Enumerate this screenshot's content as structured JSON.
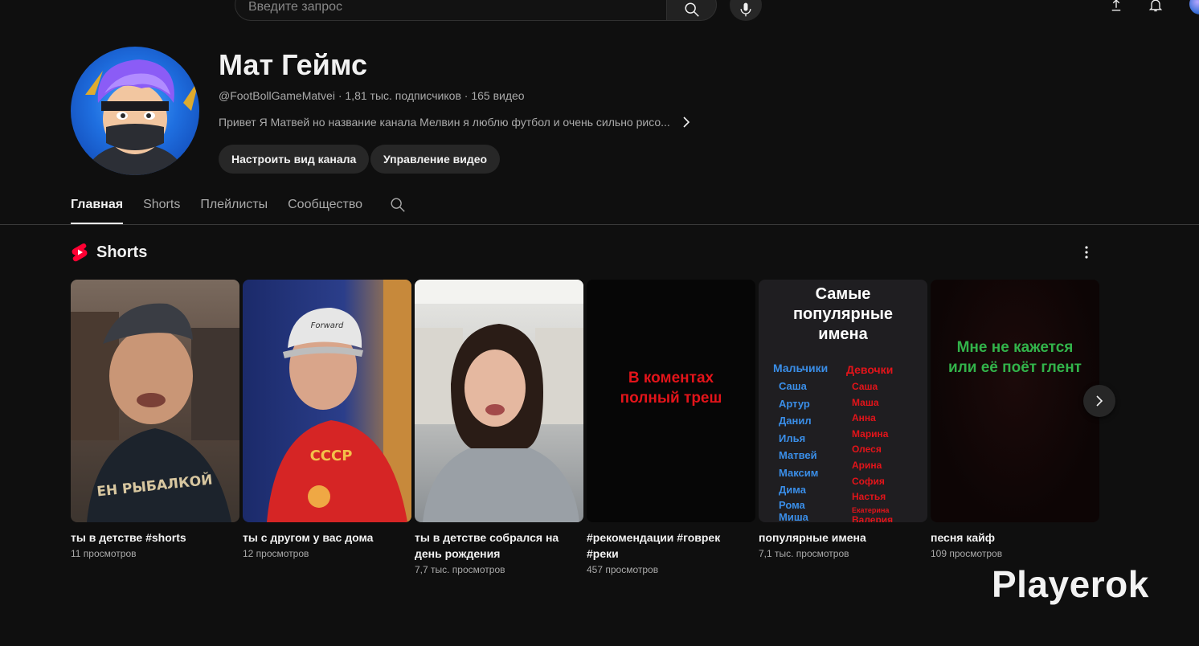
{
  "topbar": {
    "search_placeholder": "Введите запрос",
    "search_icon": "search-icon",
    "mic_icon": "mic-icon",
    "upload_icon": "upload-icon",
    "bell_icon": "bell-icon"
  },
  "channel": {
    "name": "Мат Геймс",
    "handle": "@FootBollGameMatvei",
    "subscribers": "1,81 тыс. подписчиков",
    "videos": "165 видео",
    "separator": " · ",
    "description": "Привет Я Матвей но название канала Мелвин я люблю футбол и очень сильно рисо...",
    "customize_label": "Настроить вид канала",
    "manage_label": "Управление видео"
  },
  "tabs": [
    {
      "label": "Главная",
      "active": true
    },
    {
      "label": "Shorts",
      "active": false
    },
    {
      "label": "Плейлисты",
      "active": false
    },
    {
      "label": "Сообщество",
      "active": false
    }
  ],
  "shelf": {
    "title": "Shorts",
    "brand_color": "#ff0033"
  },
  "shorts": [
    {
      "title": "ты в детстве #shorts",
      "views": "11 просмотров"
    },
    {
      "title": "ты с другом у вас дома",
      "views": "12 просмотров"
    },
    {
      "title": "ты в детстве собрался на день рождения",
      "views": "7,7 тыс. просмотров"
    },
    {
      "title": "#рекомендации #говрек #реки",
      "views": "457 просмотров",
      "overlay": "В коментах полный треш"
    },
    {
      "title": "популярные имена",
      "views": "7,1 тыс. просмотров",
      "overlay": "Самые популярные имена",
      "boys_header": "Мальчики",
      "girls_header": "Девочки",
      "boys": [
        "Саша",
        "Артур",
        "Данил",
        "Илья",
        "Матвей",
        "Максим",
        "Дима",
        "Рома",
        "Миша"
      ],
      "girls": [
        "Саша",
        "Маша",
        "Анна",
        "Марина",
        "Олеся",
        "Арина",
        "София",
        "Настья",
        "Екатерина",
        "Валерия"
      ]
    },
    {
      "title": "песня кайф",
      "views": "109 просмотров",
      "overlay": "Мне не кажется или её поёт глент"
    }
  ],
  "shirt_text_1": "ЕН РЫБАЛКОЙ",
  "cap_text": "Forward",
  "shirt_text_2": "СССР",
  "watermark": "Playerok"
}
